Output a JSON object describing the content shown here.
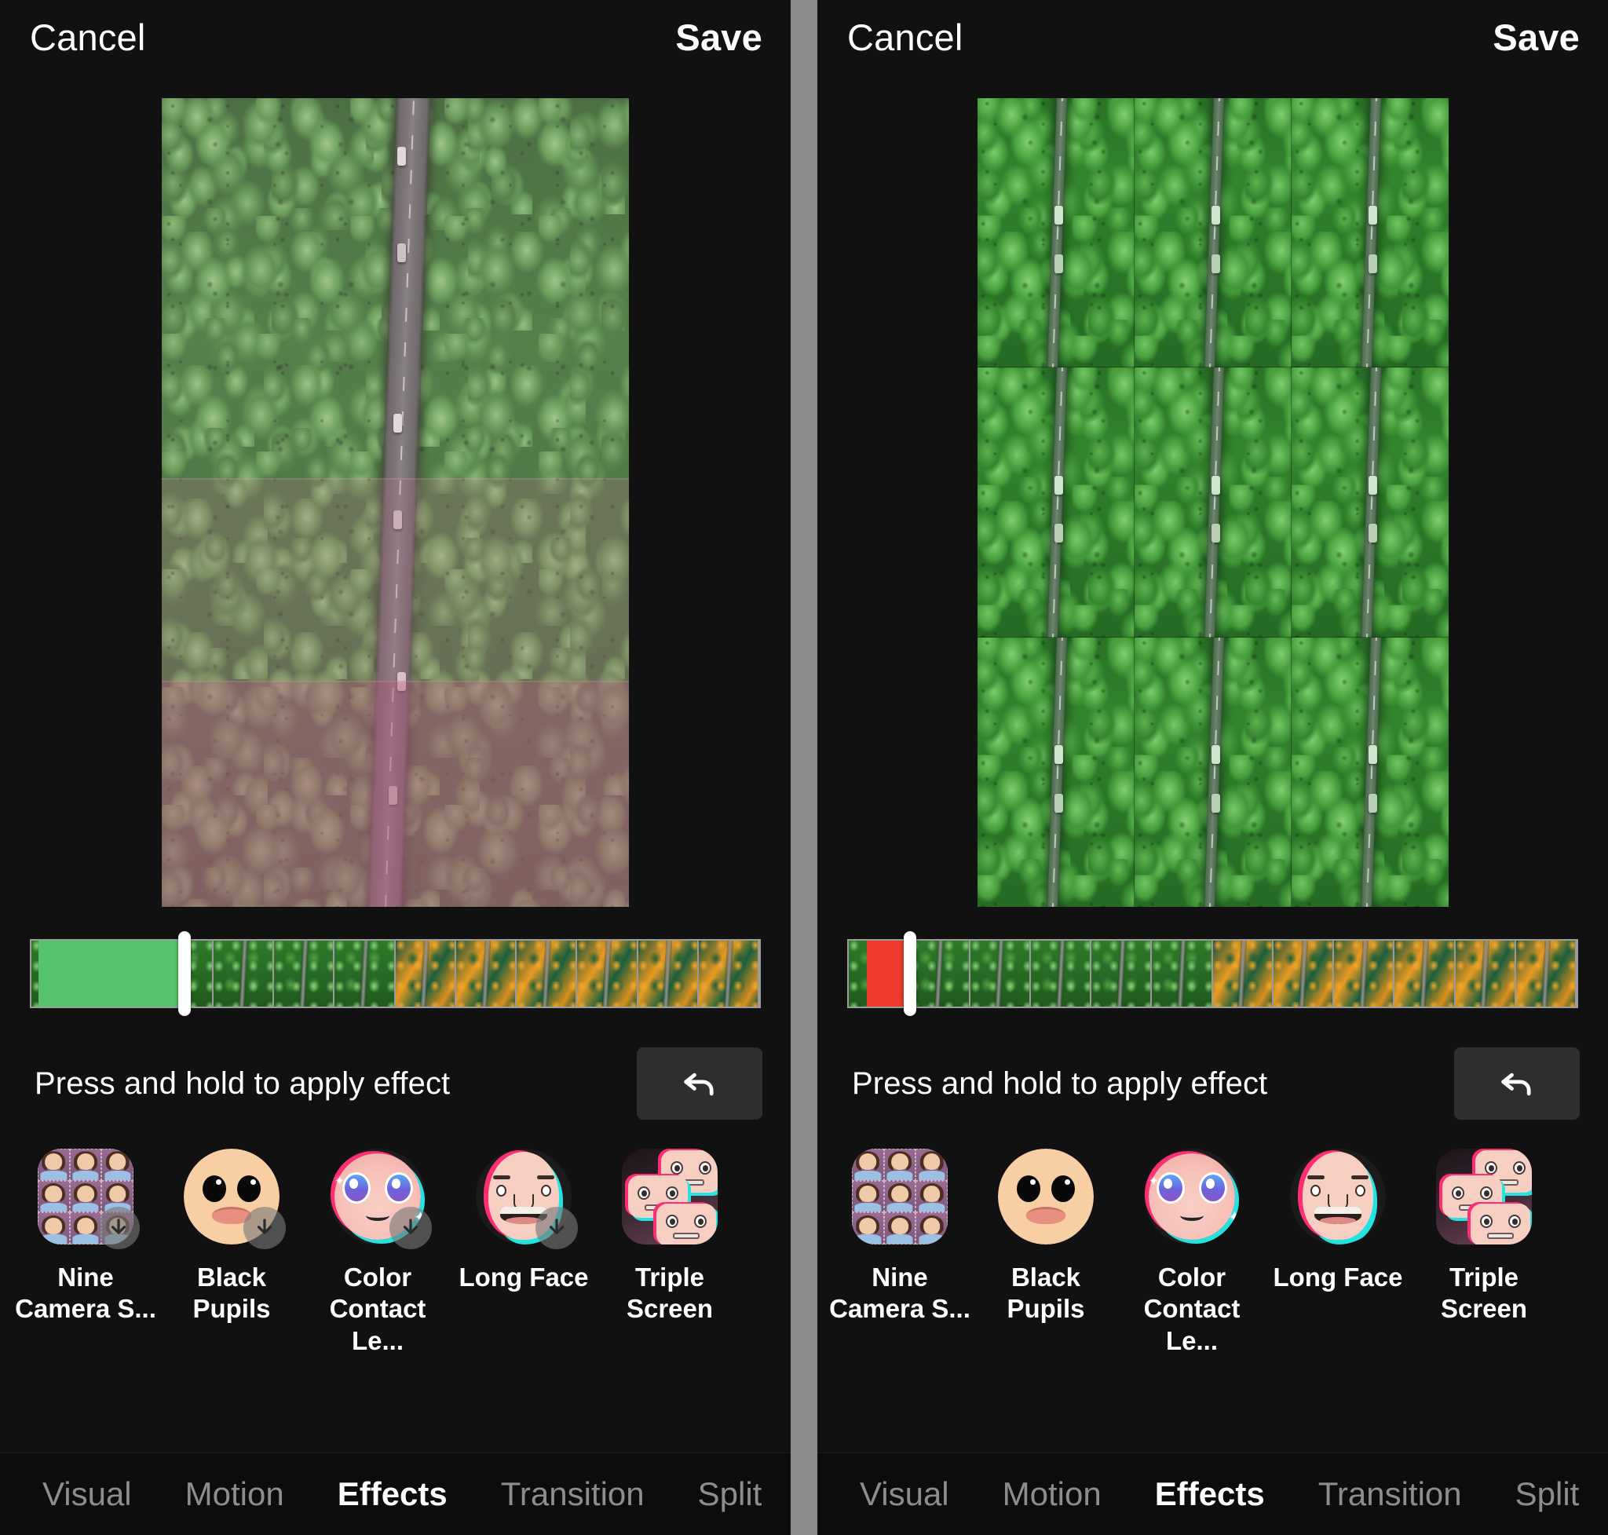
{
  "panels": [
    {
      "id": "left",
      "header": {
        "cancel_label": "Cancel",
        "save_label": "Save"
      },
      "preview": {
        "description": "Aerial view of a forest road with cars, tinted pink in lower bands",
        "effect_applied": "pink tint bands"
      },
      "timeline": {
        "selected_segment_color": "#56c26a",
        "playhead_position_percent": 21,
        "segment_start_percent": 0,
        "segment_end_percent": 21
      },
      "hint": {
        "text": "Press and hold to apply effect",
        "undo_icon": "undo-arrow-icon"
      },
      "effects": [
        {
          "label": "Nine Camera S...",
          "icon": "nine-camera-screen-icon",
          "downloadable": true
        },
        {
          "label": "Black Pupils",
          "icon": "black-pupils-face-icon",
          "downloadable": true
        },
        {
          "label": "Color Contact Le...",
          "icon": "color-contact-lenses-icon",
          "downloadable": true
        },
        {
          "label": "Long Face",
          "icon": "long-face-icon",
          "downloadable": true
        },
        {
          "label": "Triple Screen",
          "icon": "triple-screen-icon",
          "downloadable": false
        }
      ],
      "tabs": [
        {
          "label": "Visual",
          "active": false
        },
        {
          "label": "Motion",
          "active": false
        },
        {
          "label": "Effects",
          "active": true
        },
        {
          "label": "Transition",
          "active": false
        },
        {
          "label": "Split",
          "active": false
        }
      ]
    },
    {
      "id": "right",
      "header": {
        "cancel_label": "Cancel",
        "save_label": "Save"
      },
      "preview": {
        "description": "Aerial view of a forest road repeated in a 3x3 grid (Nine Camera Screen effect)",
        "effect_applied": "nine camera screen"
      },
      "timeline": {
        "selected_segment_color": "#ef3b2c",
        "playhead_position_percent": 8,
        "segment_start_percent": 2,
        "segment_end_percent": 8
      },
      "hint": {
        "text": "Press and hold to apply effect",
        "undo_icon": "undo-arrow-icon"
      },
      "effects": [
        {
          "label": "Nine Camera S...",
          "icon": "nine-camera-screen-icon",
          "downloadable": false
        },
        {
          "label": "Black Pupils",
          "icon": "black-pupils-face-icon",
          "downloadable": false
        },
        {
          "label": "Color Contact Le...",
          "icon": "color-contact-lenses-icon",
          "downloadable": false
        },
        {
          "label": "Long Face",
          "icon": "long-face-icon",
          "downloadable": false
        },
        {
          "label": "Triple Screen",
          "icon": "triple-screen-icon",
          "downloadable": false
        }
      ],
      "tabs": [
        {
          "label": "Visual",
          "active": false
        },
        {
          "label": "Motion",
          "active": false
        },
        {
          "label": "Effects",
          "active": true
        },
        {
          "label": "Transition",
          "active": false
        },
        {
          "label": "Split",
          "active": false
        }
      ]
    }
  ],
  "theme": {
    "background": "#111111",
    "divider": "#8c8c8c",
    "text_primary": "#ffffff",
    "text_muted": "#8d8d8d",
    "accent_green": "#56c26a",
    "accent_red": "#ef3b2c"
  }
}
